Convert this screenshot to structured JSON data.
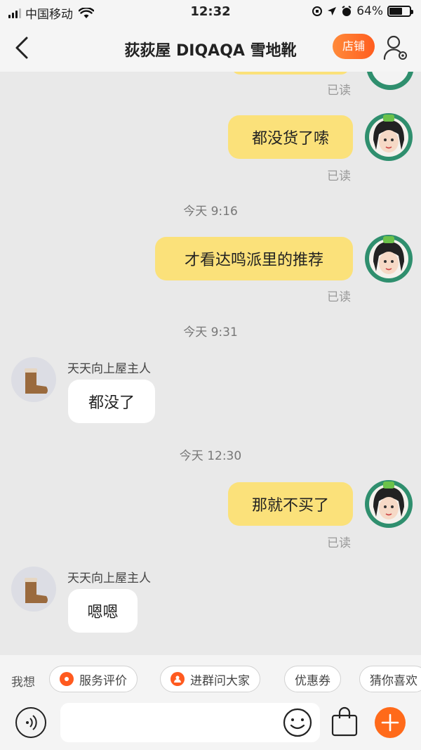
{
  "status": {
    "carrier": "中国移动",
    "time": "12:32",
    "battery": "64%",
    "battery_level": 0.64
  },
  "header": {
    "title": "荻荻屋 DIQAQA 雪地靴",
    "shop_label": "店铺"
  },
  "chat": {
    "top_read": "已读",
    "msg1": {
      "text": "都没货了嗦",
      "read": "已读"
    },
    "time1": "今天 9:16",
    "msg2": {
      "text": "才看达鸣派里的推荐",
      "read": "已读"
    },
    "time2": "今天 9:31",
    "msg3": {
      "sender": "天天向上屋主人",
      "text": "都没了"
    },
    "time3": "今天 12:30",
    "msg4": {
      "text": "那就不买了",
      "read": "已读"
    },
    "msg5": {
      "sender": "天天向上屋主人",
      "text": "嗯嗯"
    }
  },
  "quickbar": {
    "label": "我想",
    "chips": [
      "服务评价",
      "进群问大家",
      "优惠券",
      "猜你喜欢"
    ]
  },
  "input": {
    "placeholder": ""
  },
  "colors": {
    "accent": "#ff6a1a",
    "bubble_out": "#fbe17a",
    "bubble_in": "#ffffff",
    "background": "#e9e9e9"
  }
}
